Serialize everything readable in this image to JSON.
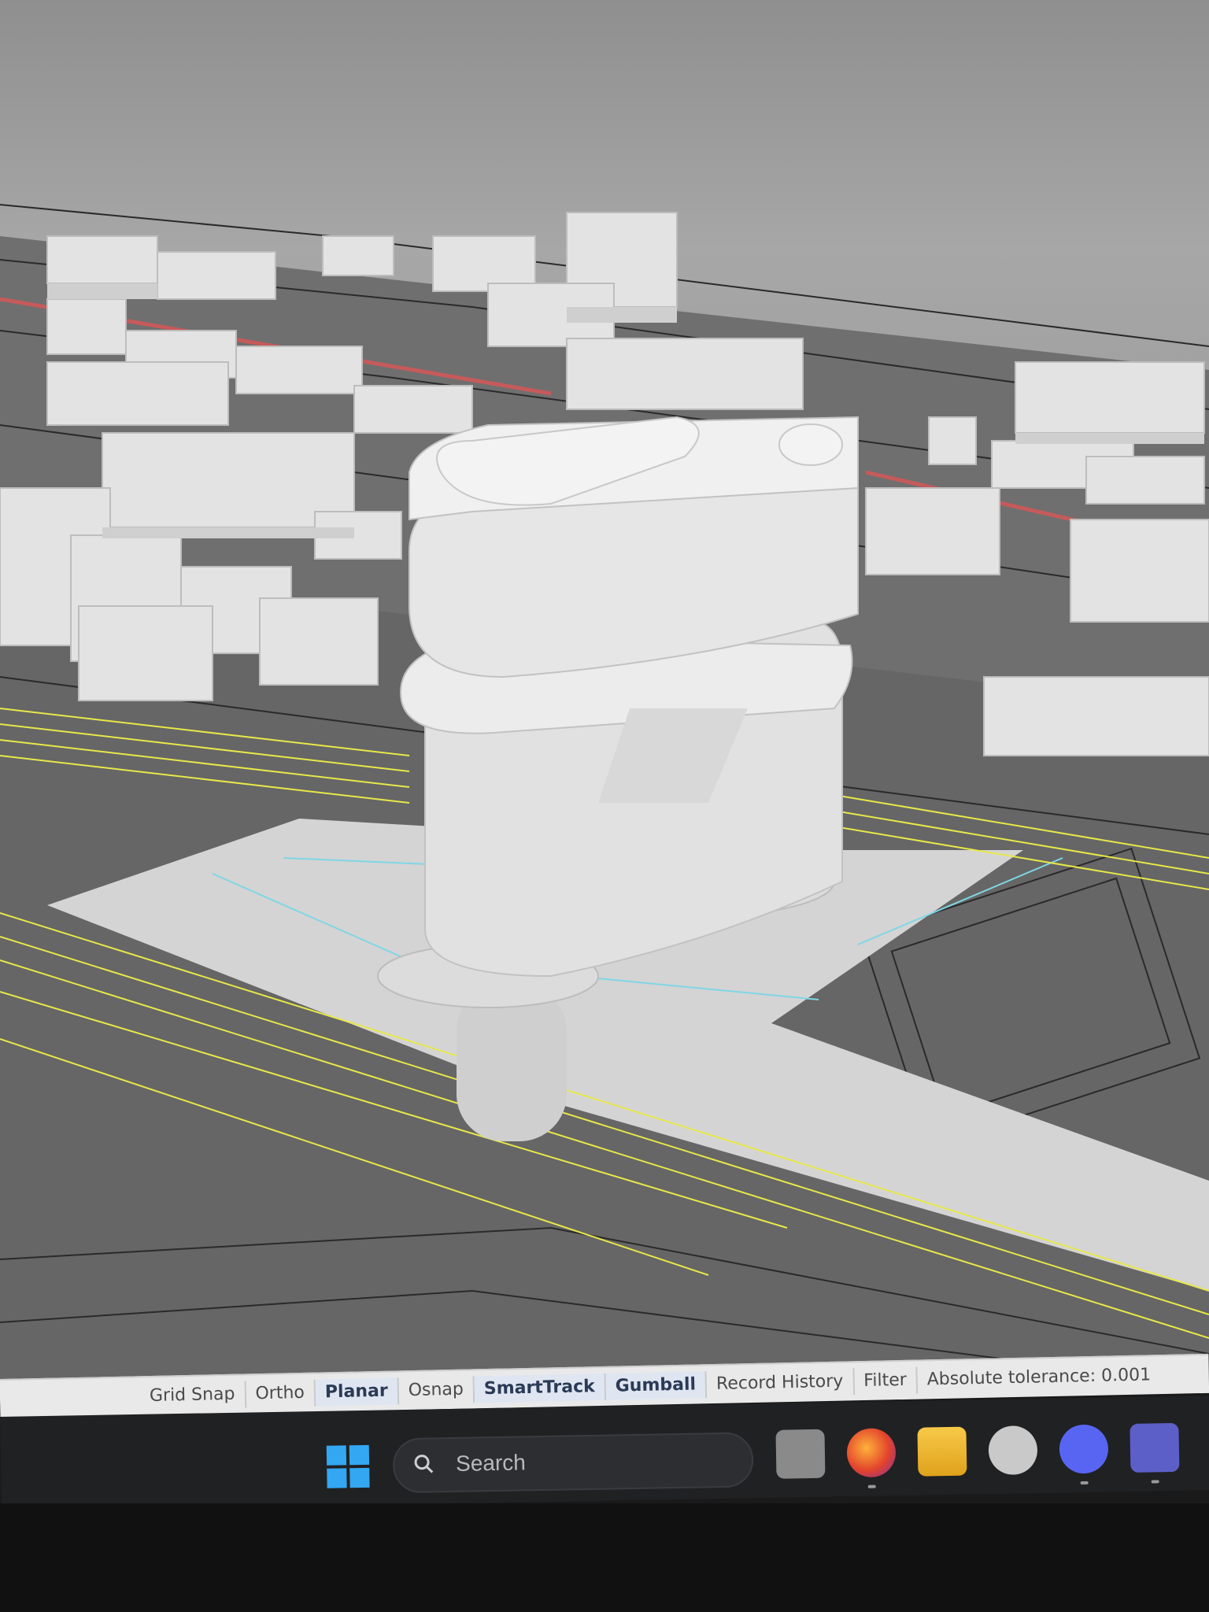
{
  "status_bar": {
    "panes": [
      {
        "label": "Grid Snap",
        "active": false
      },
      {
        "label": "Ortho",
        "active": false
      },
      {
        "label": "Planar",
        "active": true
      },
      {
        "label": "Osnap",
        "active": false
      },
      {
        "label": "SmartTrack",
        "active": true
      },
      {
        "label": "Gumball",
        "active": true
      },
      {
        "label": "Record History",
        "active": false
      },
      {
        "label": "Filter",
        "active": false
      }
    ],
    "tolerance_text": "Absolute tolerance: 0.001"
  },
  "taskbar": {
    "search_label": "Search",
    "apps": [
      "task-view-icon",
      "firefox-icon",
      "file-explorer-icon",
      "creative-cloud-icon",
      "discord-icon",
      "teams-icon"
    ]
  },
  "colors": {
    "accent_windows": "#33a7f2",
    "road_lines": "#e8e84a",
    "selection_lines": "#7fd6e6",
    "rail_line": "#c65a5a"
  }
}
